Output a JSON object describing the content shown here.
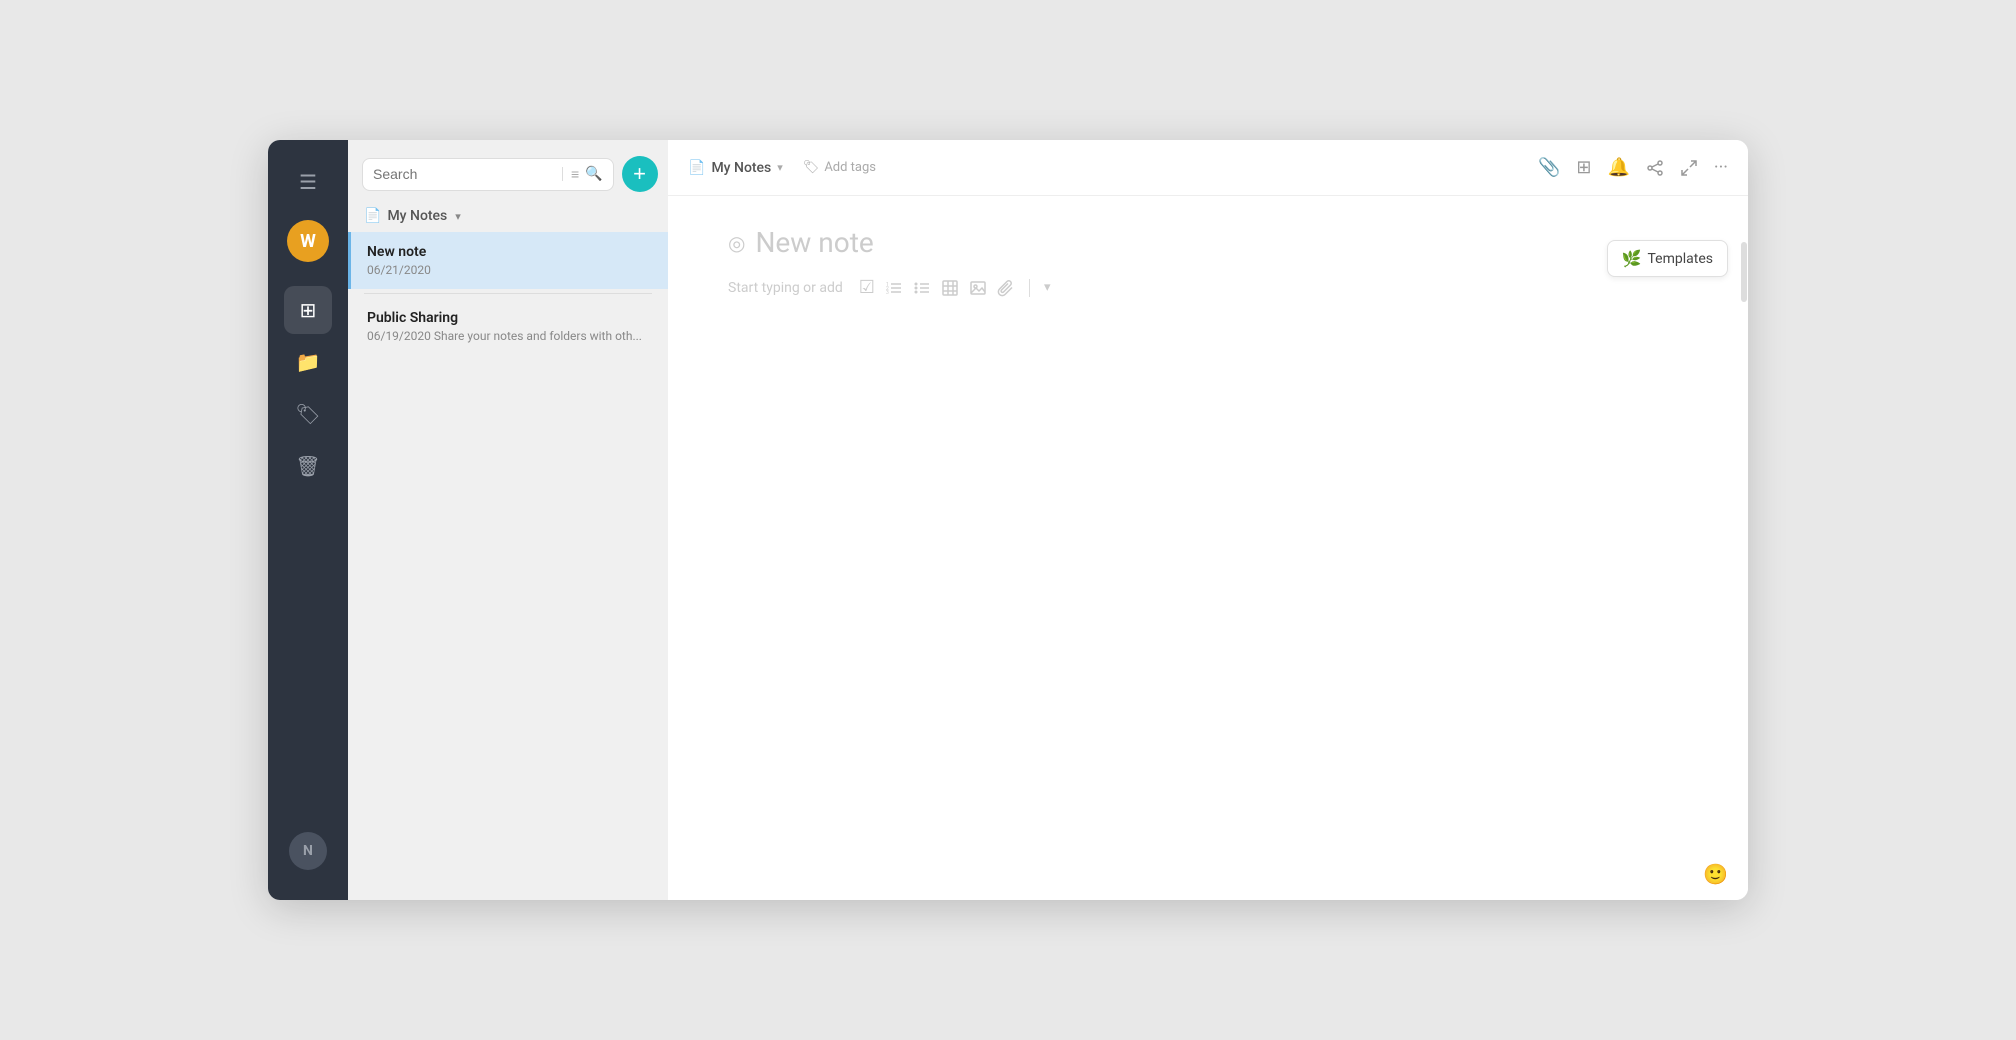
{
  "nav": {
    "menu_label": "☰",
    "avatar_letter": "W",
    "bottom_avatar_letter": "N",
    "items": [
      {
        "icon": "⊞",
        "label": "dashboard",
        "active": false
      },
      {
        "icon": "📁",
        "label": "folders",
        "active": false
      },
      {
        "icon": "🏷",
        "label": "tags",
        "active": false
      },
      {
        "icon": "🗑",
        "label": "trash",
        "active": false
      }
    ]
  },
  "sidebar": {
    "search_placeholder": "Search",
    "filter_icon": "≡",
    "search_icon": "🔍",
    "add_btn_label": "+",
    "section": {
      "folder_icon": "📄",
      "title": "My Notes",
      "chevron": "▾"
    },
    "notes": [
      {
        "title": "New note",
        "date": "06/21/2020",
        "preview": "",
        "active": true
      },
      {
        "title": "Public Sharing",
        "date": "06/19/2020",
        "preview": "Share your notes and folders with oth...",
        "active": false
      }
    ]
  },
  "header": {
    "folder_icon": "📄",
    "note_location": "My Notes",
    "chevron": "▾",
    "tag_icon": "🏷",
    "add_tags_label": "Add tags",
    "actions": {
      "attachment": "📎",
      "grid": "⊞",
      "bell": "🔔",
      "share": "⎇",
      "expand": "⤢",
      "more": "···"
    }
  },
  "templates_btn": {
    "icon": "🌿",
    "label": "Templates"
  },
  "editor": {
    "title_placeholder": "New note",
    "title_icon": "◎",
    "toolbar": {
      "start_typing": "Start typing or add",
      "icons": [
        "☑",
        "≡",
        "≔",
        "⊞",
        "🖼",
        "📎"
      ]
    }
  }
}
